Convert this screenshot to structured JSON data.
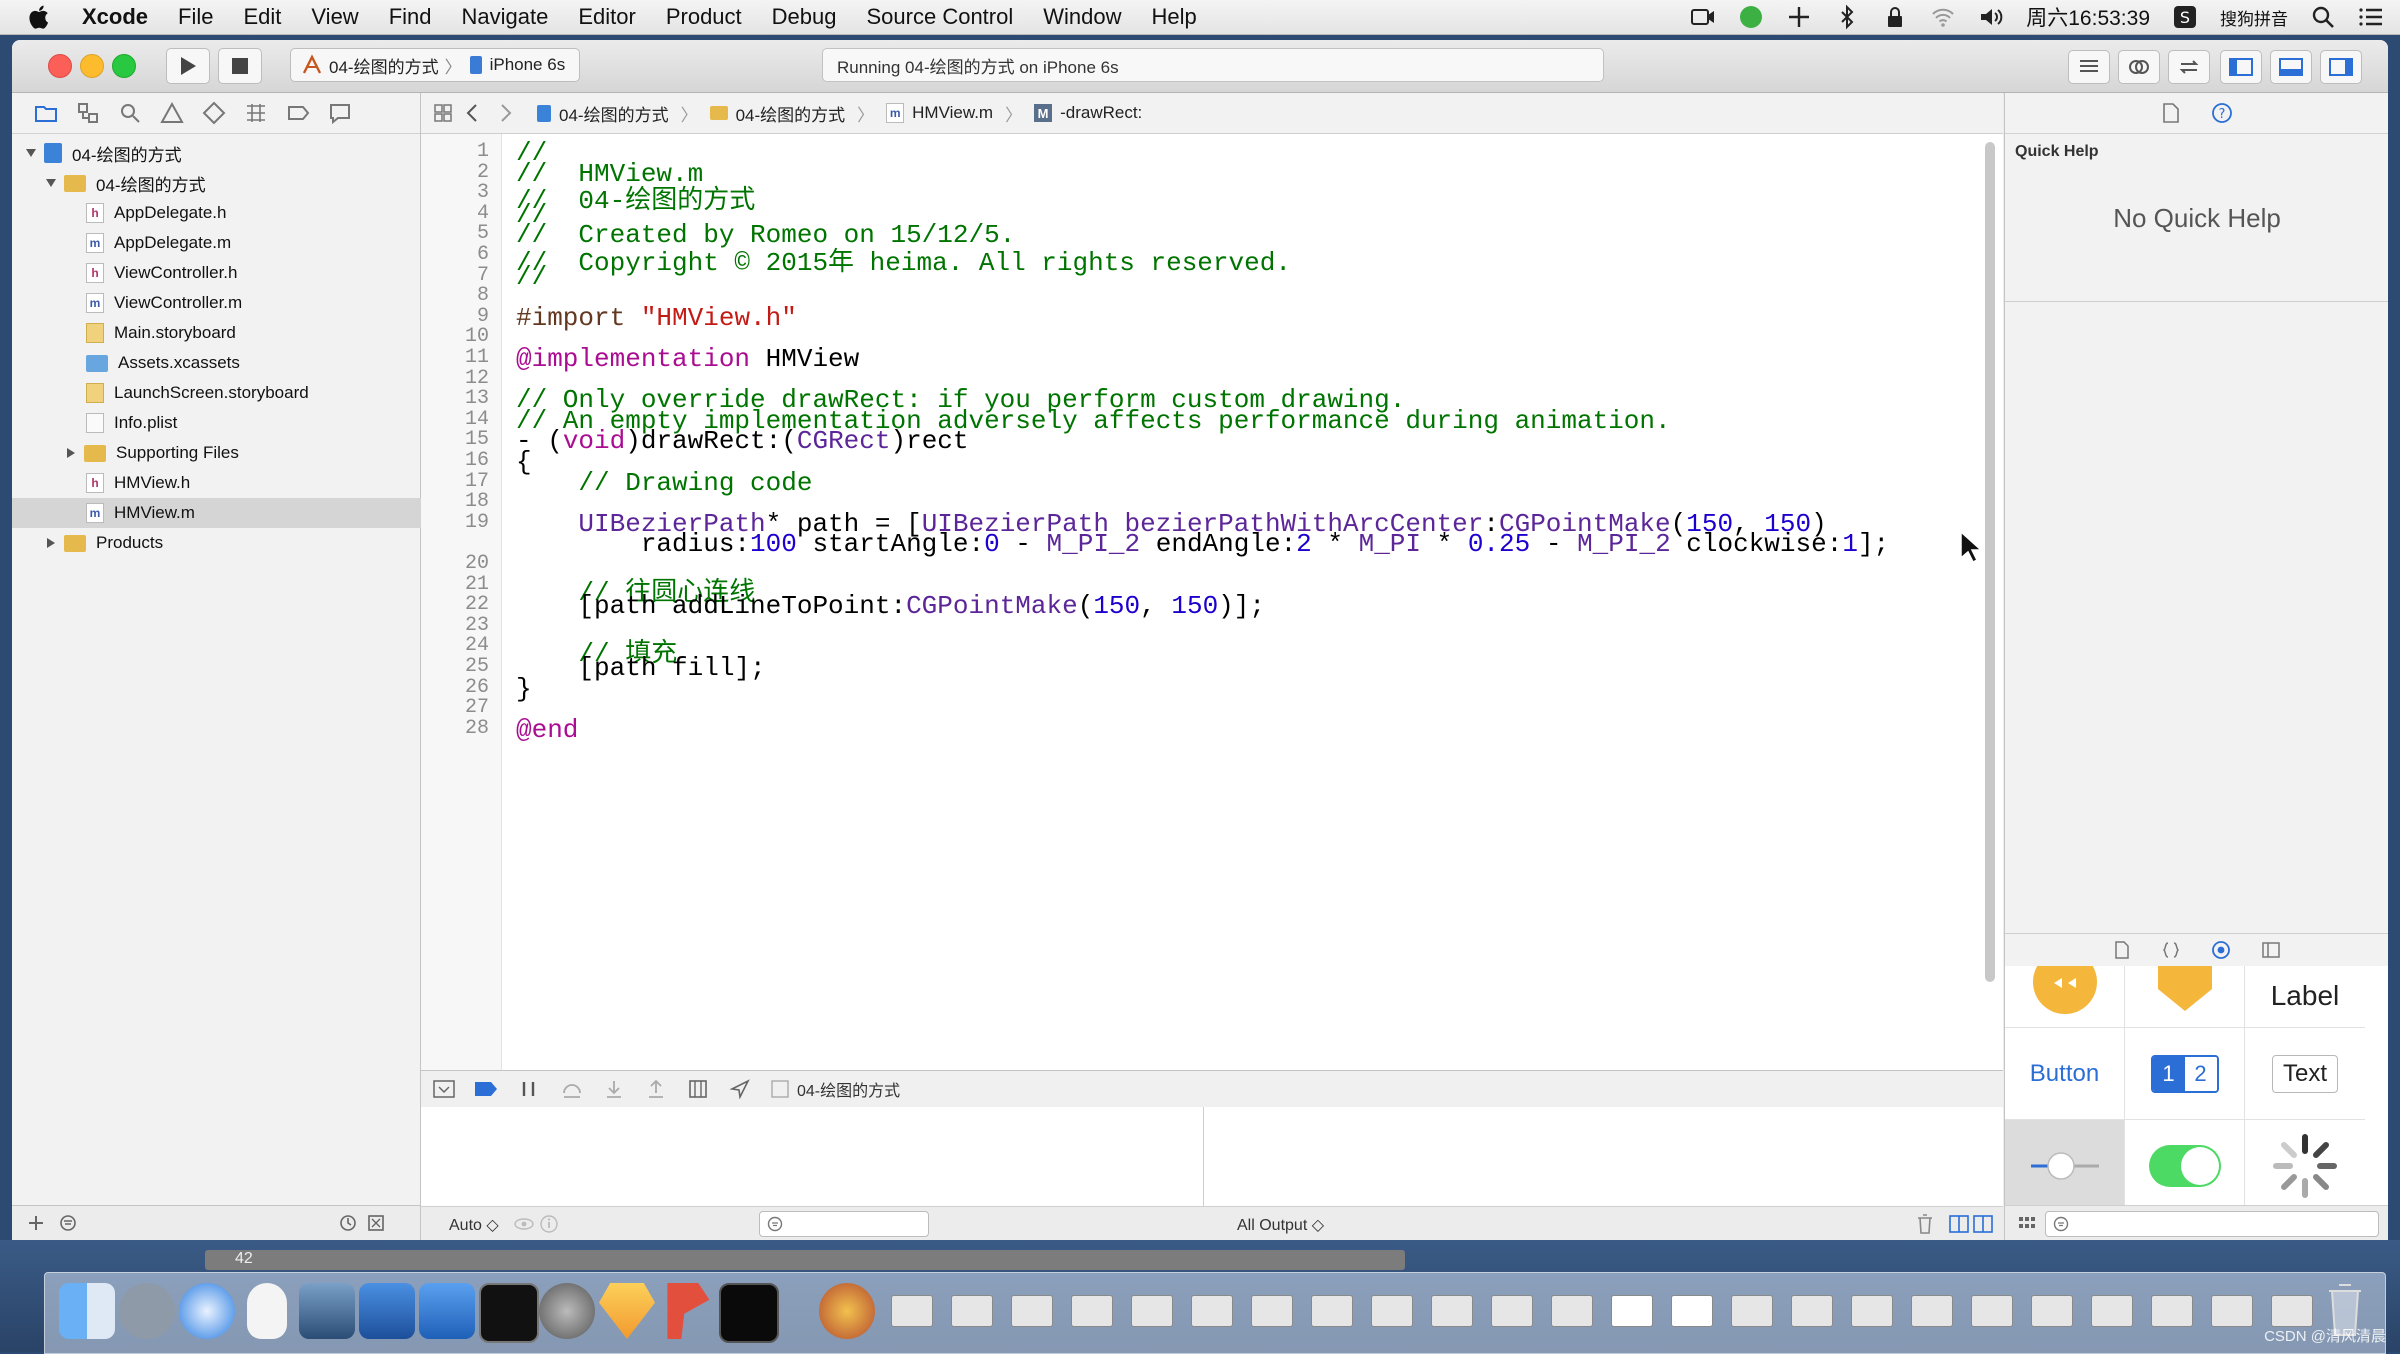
{
  "menubar": {
    "app": "Xcode",
    "items": [
      "File",
      "Edit",
      "View",
      "Find",
      "Navigate",
      "Editor",
      "Product",
      "Debug",
      "Source Control",
      "Window",
      "Help"
    ],
    "clock": "周六16:53:39",
    "input_method": "搜狗拼音"
  },
  "toolbar": {
    "scheme": "04-绘图的方式",
    "device": "iPhone 6s",
    "activity": "Running 04-绘图的方式 on iPhone 6s"
  },
  "navigator": {
    "items": [
      {
        "label": "04-绘图的方式",
        "kind": "project",
        "depth": 0,
        "expanded": true
      },
      {
        "label": "04-绘图的方式",
        "kind": "folder",
        "depth": 1,
        "expanded": true
      },
      {
        "label": "AppDelegate.h",
        "kind": "h",
        "depth": 2
      },
      {
        "label": "AppDelegate.m",
        "kind": "m",
        "depth": 2
      },
      {
        "label": "ViewController.h",
        "kind": "h",
        "depth": 2
      },
      {
        "label": "ViewController.m",
        "kind": "m",
        "depth": 2
      },
      {
        "label": "Main.storyboard",
        "kind": "storyboard",
        "depth": 2
      },
      {
        "label": "Assets.xcassets",
        "kind": "assets",
        "depth": 2
      },
      {
        "label": "LaunchScreen.storyboard",
        "kind": "storyboard",
        "depth": 2
      },
      {
        "label": "Info.plist",
        "kind": "plist",
        "depth": 2
      },
      {
        "label": "Supporting Files",
        "kind": "folder",
        "depth": 2,
        "expanded": false
      },
      {
        "label": "HMView.h",
        "kind": "h",
        "depth": 2
      },
      {
        "label": "HMView.m",
        "kind": "m",
        "depth": 2,
        "selected": true
      },
      {
        "label": "Products",
        "kind": "folder",
        "depth": 1,
        "expanded": false
      }
    ]
  },
  "jumpbar": {
    "crumbs": [
      "04-绘图的方式",
      "04-绘图的方式",
      "HMView.m",
      "-drawRect:"
    ]
  },
  "editor": {
    "lines": [
      {
        "n": "1",
        "t": "//"
      },
      {
        "n": "2",
        "t": "//  HMView.m"
      },
      {
        "n": "3",
        "t": "//  04-绘图的方式"
      },
      {
        "n": "4",
        "t": "//"
      },
      {
        "n": "5",
        "t": "//  Created by Romeo on 15/12/5."
      },
      {
        "n": "6",
        "t": "//  Copyright © 2015年 heima. All rights reserved."
      },
      {
        "n": "7",
        "t": "//"
      },
      {
        "n": "8",
        "t": ""
      },
      {
        "n": "9",
        "t": "#import \"HMView.h\""
      },
      {
        "n": "10",
        "t": ""
      },
      {
        "n": "11",
        "t": "@implementation HMView"
      },
      {
        "n": "12",
        "t": ""
      },
      {
        "n": "13",
        "t": "// Only override drawRect: if you perform custom drawing."
      },
      {
        "n": "14",
        "t": "// An empty implementation adversely affects performance during animation."
      },
      {
        "n": "15",
        "t": "- (void)drawRect:(CGRect)rect"
      },
      {
        "n": "16",
        "t": "{"
      },
      {
        "n": "17",
        "t": "    // Drawing code"
      },
      {
        "n": "18",
        "t": ""
      },
      {
        "n": "19",
        "t": "    UIBezierPath* path = [UIBezierPath bezierPathWithArcCenter:CGPointMake(150, 150)"
      },
      {
        "n": "",
        "t": "        radius:100 startAngle:0 - M_PI_2 endAngle:2 * M_PI * 0.25 - M_PI_2 clockwise:1];"
      },
      {
        "n": "20",
        "t": ""
      },
      {
        "n": "21",
        "t": "    // 往圆心连线"
      },
      {
        "n": "22",
        "t": "    [path addLineToPoint:CGPointMake(150, 150)];"
      },
      {
        "n": "23",
        "t": ""
      },
      {
        "n": "24",
        "t": "    // 填充"
      },
      {
        "n": "25",
        "t": "    [path fill];"
      },
      {
        "n": "26",
        "t": "}"
      },
      {
        "n": "27",
        "t": ""
      },
      {
        "n": "28",
        "t": "@end"
      }
    ]
  },
  "debug": {
    "target": "04-绘图的方式",
    "variables_filter": "Auto ◇",
    "output_filter": "All Output ◇"
  },
  "inspector": {
    "quick_help_title": "Quick Help",
    "quick_help_empty": "No Quick Help",
    "library": {
      "label": "Label",
      "button": "Button",
      "seg1": "1",
      "seg2": "2",
      "text": "Text"
    }
  },
  "colors": {
    "comment": "#007400",
    "keyword": "#aa0d91",
    "string": "#c41a16",
    "number": "#1c00cf",
    "type": "#5c2699",
    "preprocessor": "#643820"
  },
  "scroll_page": "42",
  "watermark": "CSDN @清风清晨"
}
